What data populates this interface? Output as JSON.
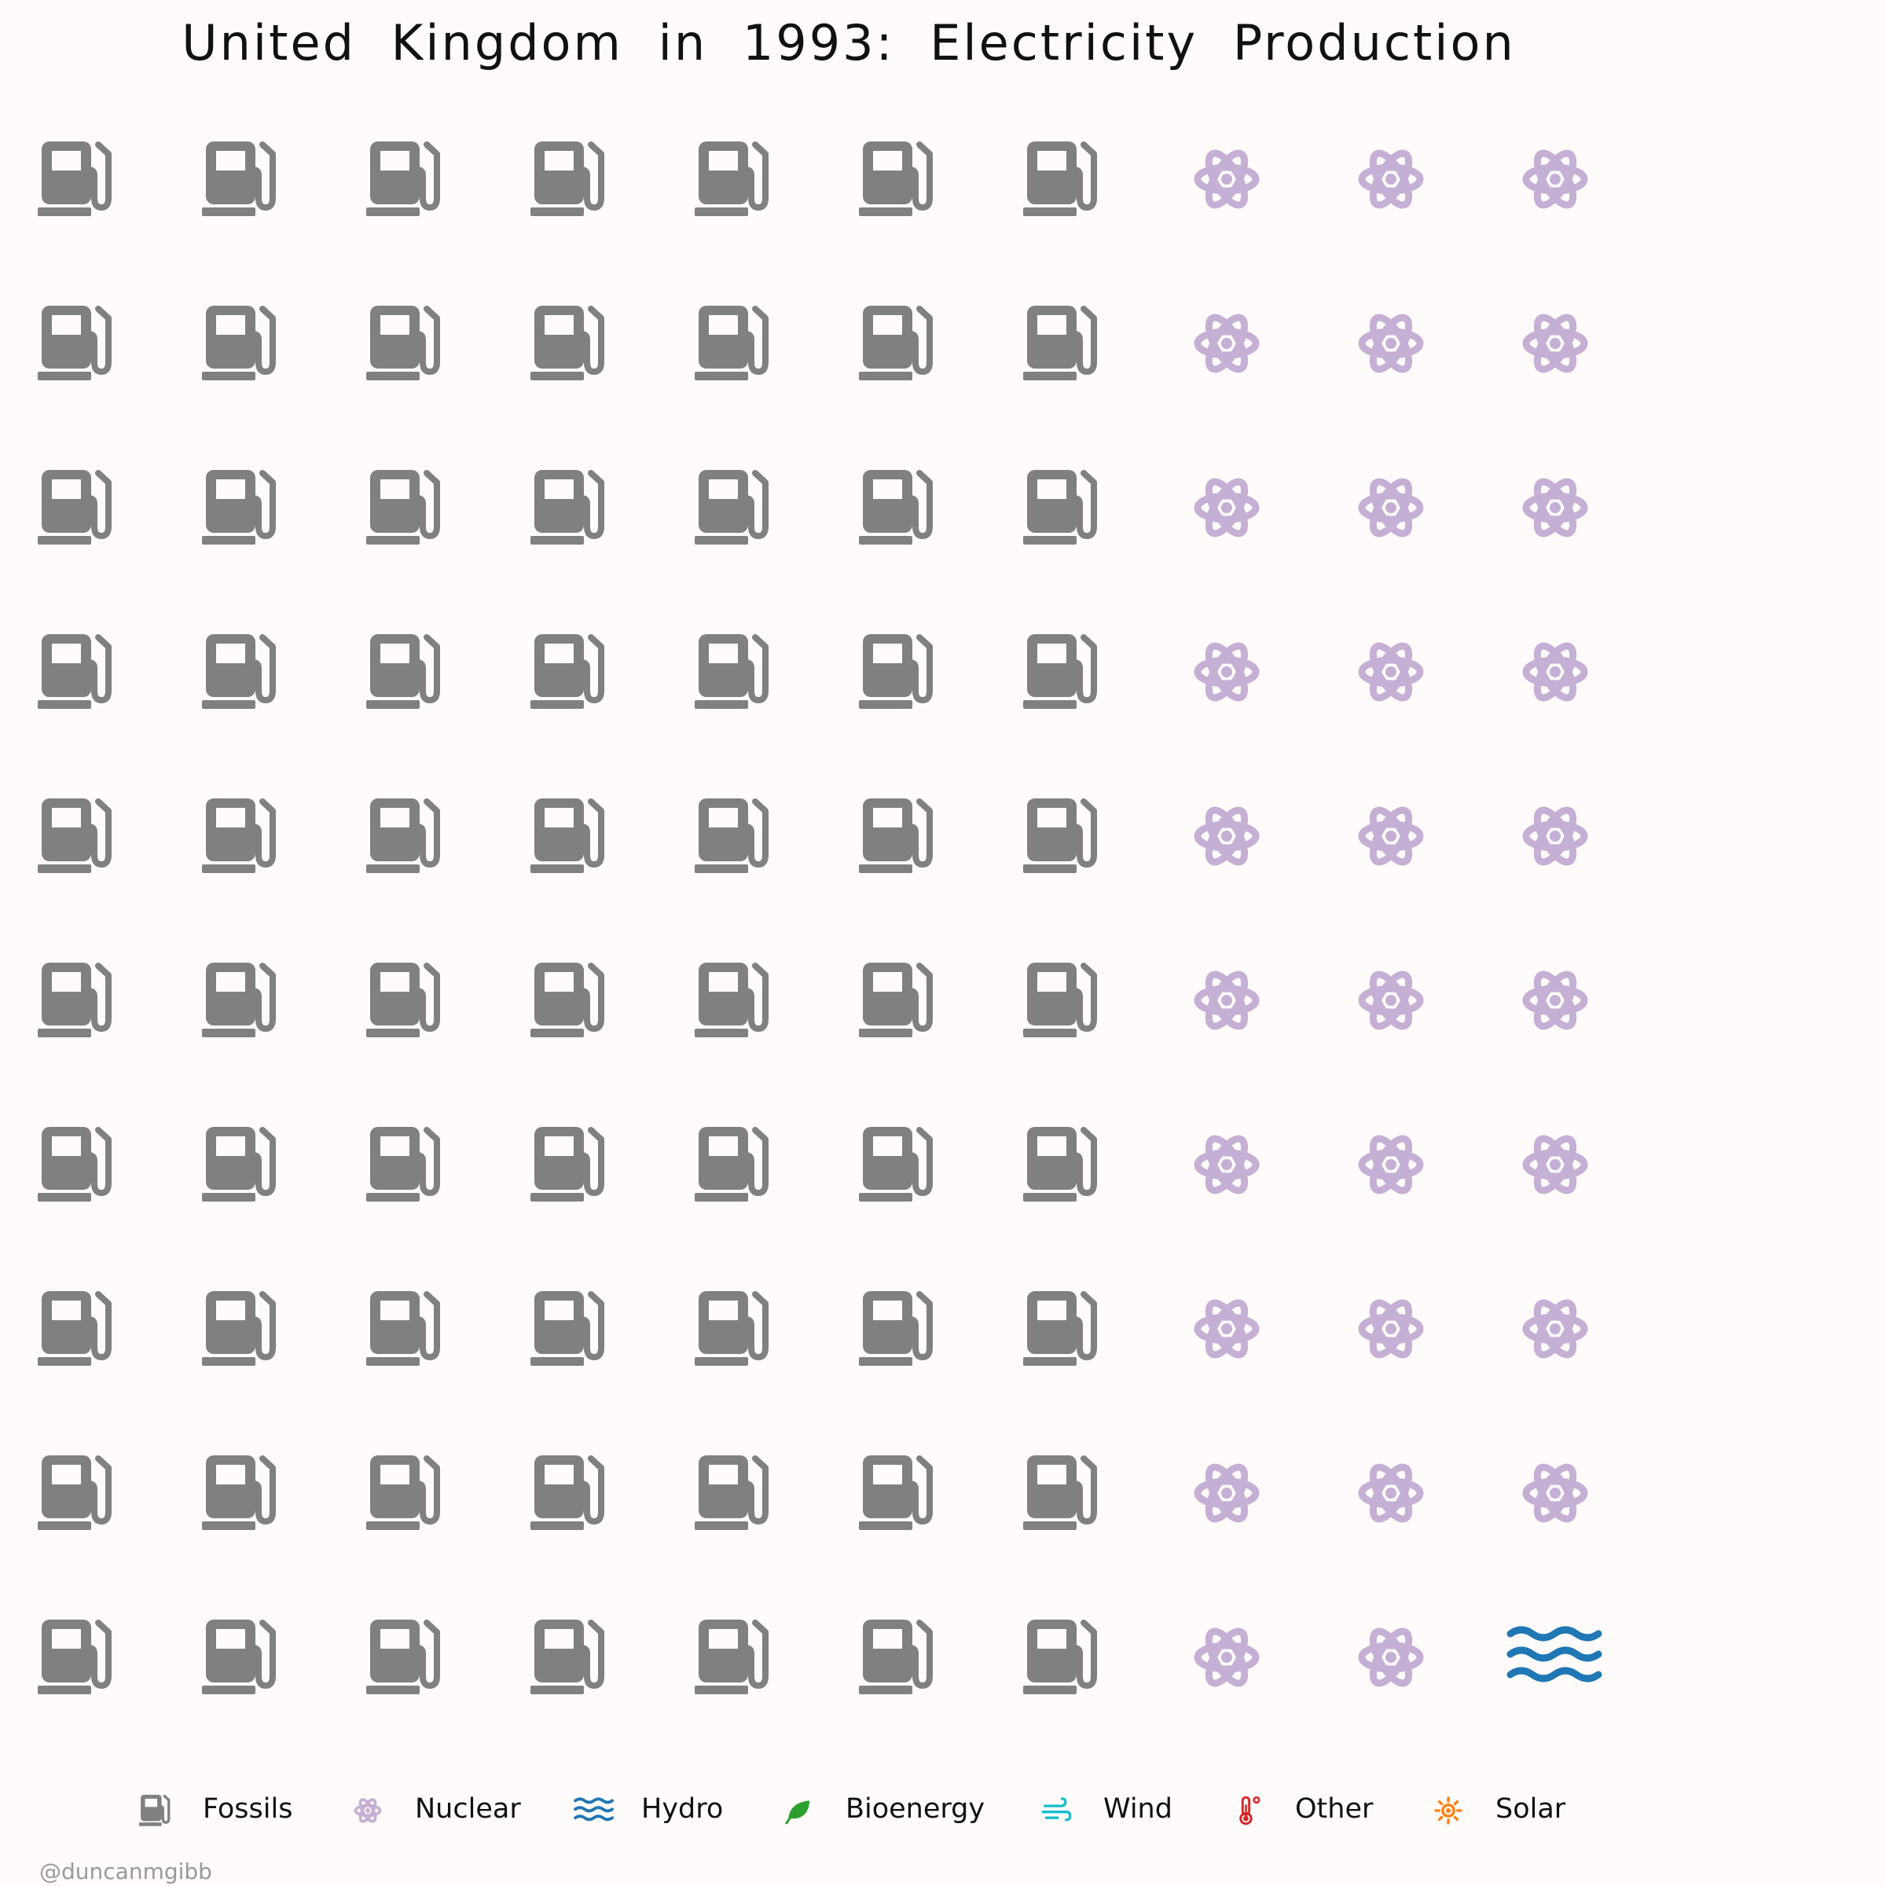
{
  "chart_data": {
    "type": "waffle",
    "title": "United Kingdom in 1993: Electricity Production",
    "grid": {
      "rows": 10,
      "columns": 10
    },
    "series": [
      {
        "name": "Fossils",
        "units": 70,
        "color": "#808080",
        "icon": "gas-pump-icon"
      },
      {
        "name": "Nuclear",
        "units": 29,
        "color": "#c5b0d5",
        "icon": "atom-icon"
      },
      {
        "name": "Hydro",
        "units": 1,
        "color": "#1f77b4",
        "icon": "water-waves-icon"
      },
      {
        "name": "Bioenergy",
        "units": 0,
        "color": "#2ca02c",
        "icon": "leaf-icon"
      },
      {
        "name": "Wind",
        "units": 0,
        "color": "#17becf",
        "icon": "wind-icon"
      },
      {
        "name": "Other",
        "units": 0,
        "color": "#d62728",
        "icon": "thermometer-icon"
      },
      {
        "name": "Solar",
        "units": 0,
        "color": "#ff7f0e",
        "icon": "sun-icon"
      }
    ],
    "legend_position": "bottom"
  },
  "credit": "@duncanmgibb"
}
